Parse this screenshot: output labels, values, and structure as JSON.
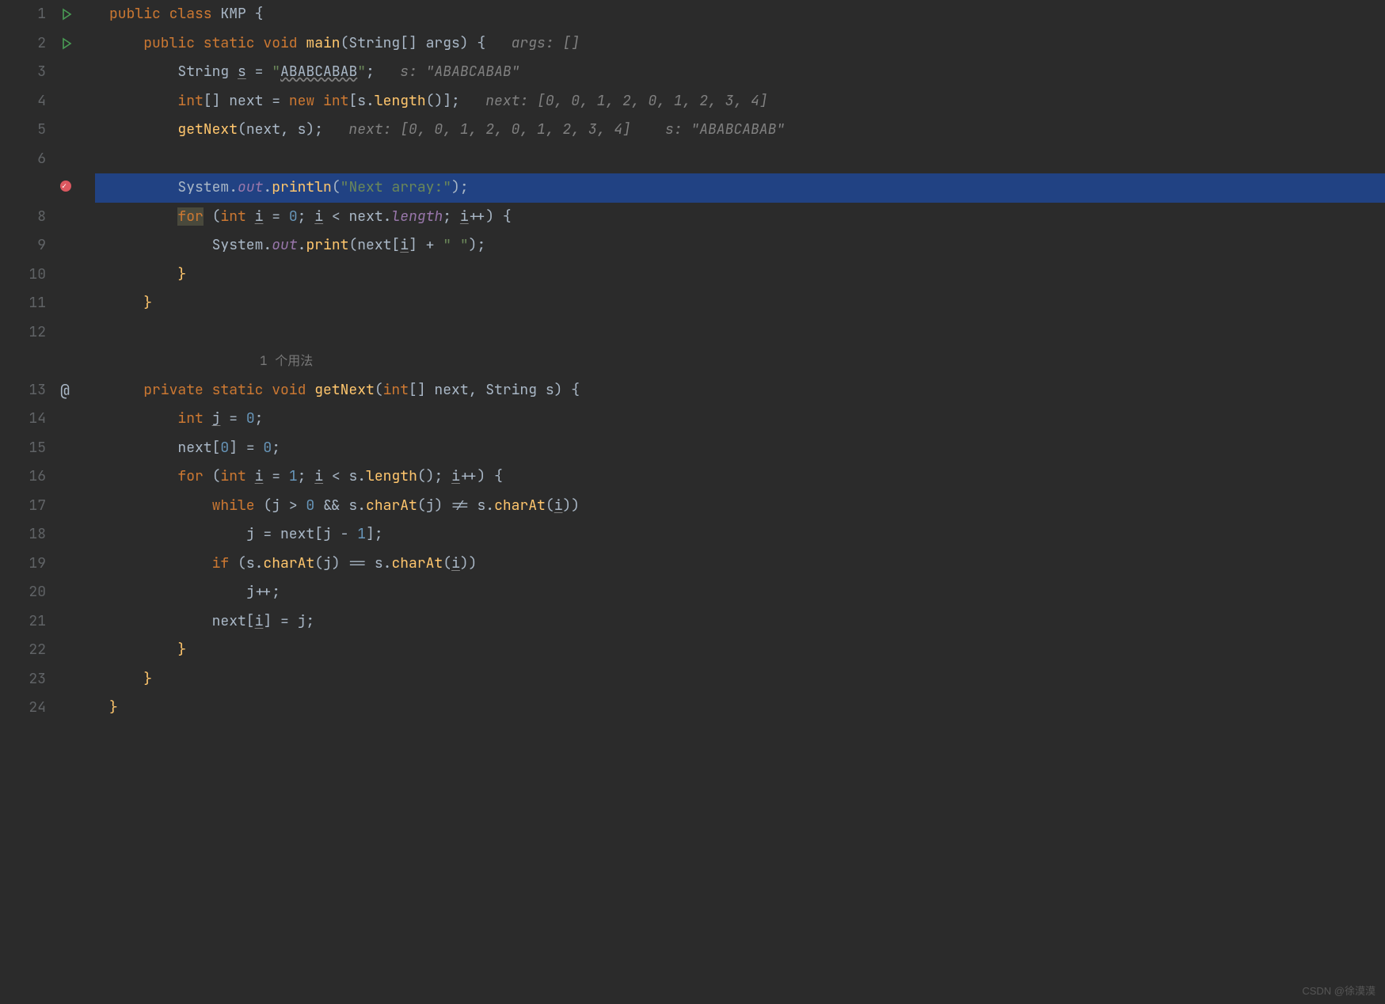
{
  "lineNumbers": [
    "1",
    "2",
    "3",
    "4",
    "5",
    "6",
    "",
    "8",
    "9",
    "10",
    "11",
    "12",
    "",
    "13",
    "14",
    "15",
    "16",
    "17",
    "18",
    "19",
    "20",
    "21",
    "22",
    "23",
    "24"
  ],
  "gutterIcons": [
    "run",
    "run",
    "",
    "",
    "",
    "",
    "breakpoint",
    "",
    "",
    "",
    "",
    "",
    "",
    "at",
    "",
    "",
    "",
    "",
    "",
    "",
    "",
    "",
    "",
    "",
    ""
  ],
  "highlightRow": 6,
  "usageHint": "1 个用法",
  "watermark": "CSDN @徐漠漠",
  "code": {
    "l1": {
      "tokens": [
        [
          "kw",
          "public "
        ],
        [
          "kw",
          "class "
        ],
        [
          "op",
          "KMP "
        ],
        [
          "brace",
          "{"
        ]
      ]
    },
    "l2": {
      "tokens": [
        [
          "",
          "    "
        ],
        [
          "kw",
          "public static "
        ],
        [
          "kw",
          "void "
        ],
        [
          "method",
          "main"
        ],
        [
          "op",
          "(String[] args) "
        ],
        [
          "brace",
          "{"
        ],
        [
          "comment",
          "   args: []"
        ]
      ]
    },
    "l3": {
      "tokens": [
        [
          "",
          "        "
        ],
        [
          "op",
          "String "
        ],
        [
          "underline",
          "s"
        ],
        [
          "op",
          " = "
        ],
        [
          "str",
          "\""
        ],
        [
          "wavy",
          "ABABCABAB"
        ],
        [
          "str",
          "\""
        ],
        [
          "op",
          ";"
        ],
        [
          "comment",
          "   s: \"ABABCABAB\""
        ]
      ]
    },
    "l4": {
      "tokens": [
        [
          "",
          "        "
        ],
        [
          "kw",
          "int"
        ],
        [
          "op",
          "[] "
        ],
        [
          "op",
          "next = "
        ],
        [
          "kw",
          "new int"
        ],
        [
          "op",
          "[s."
        ],
        [
          "method",
          "length"
        ],
        [
          "op",
          "()];"
        ],
        [
          "comment",
          "   next: [0, 0, 1, 2, 0, 1, 2, 3, 4]"
        ]
      ]
    },
    "l5": {
      "tokens": [
        [
          "",
          "        "
        ],
        [
          "method",
          "getNext"
        ],
        [
          "op",
          "(next, s);"
        ],
        [
          "comment",
          "   next: [0, 0, 1, 2, 0, 1, 2, 3, 4]    s: \"ABABCABAB\""
        ]
      ]
    },
    "l6": {
      "tokens": [
        [
          "",
          ""
        ]
      ]
    },
    "l7": {
      "tokens": [
        [
          "",
          "        "
        ],
        [
          "op",
          "System."
        ],
        [
          "field",
          "out"
        ],
        [
          "op",
          "."
        ],
        [
          "method",
          "println"
        ],
        [
          "op",
          "("
        ],
        [
          "str",
          "\"Next array:\""
        ],
        [
          "op",
          ");"
        ]
      ]
    },
    "l8": {
      "tokens": [
        [
          "",
          "        "
        ],
        [
          "selkw",
          "for"
        ],
        [
          "op",
          " ("
        ],
        [
          "kw",
          "int "
        ],
        [
          "underline",
          "i"
        ],
        [
          "op",
          " = "
        ],
        [
          "num",
          "0"
        ],
        [
          "op",
          "; "
        ],
        [
          "underline",
          "i"
        ],
        [
          "op",
          " < next."
        ],
        [
          "field",
          "length"
        ],
        [
          "op",
          "; "
        ],
        [
          "underline",
          "i"
        ],
        [
          "op",
          "++) "
        ],
        [
          "brace",
          "{"
        ]
      ]
    },
    "l9": {
      "tokens": [
        [
          "",
          "            "
        ],
        [
          "op",
          "System."
        ],
        [
          "field",
          "out"
        ],
        [
          "op",
          "."
        ],
        [
          "method",
          "print"
        ],
        [
          "op",
          "(next["
        ],
        [
          "underline",
          "i"
        ],
        [
          "op",
          "] + "
        ],
        [
          "str",
          "\" \""
        ],
        [
          "op",
          ");"
        ]
      ]
    },
    "l10": {
      "tokens": [
        [
          "",
          "        "
        ],
        [
          "cbrace",
          "}"
        ]
      ]
    },
    "l11": {
      "tokens": [
        [
          "",
          "    "
        ],
        [
          "cbrace",
          "}"
        ]
      ]
    },
    "l12": {
      "tokens": [
        [
          "",
          ""
        ]
      ]
    },
    "l13": {
      "tokens": [
        [
          "",
          "    "
        ],
        [
          "kw",
          "private static "
        ],
        [
          "kw",
          "void "
        ],
        [
          "method",
          "getNext"
        ],
        [
          "op",
          "("
        ],
        [
          "kw",
          "int"
        ],
        [
          "op",
          "[] next, String s) "
        ],
        [
          "brace",
          "{"
        ]
      ]
    },
    "l14": {
      "tokens": [
        [
          "",
          "        "
        ],
        [
          "kw",
          "int "
        ],
        [
          "underline",
          "j"
        ],
        [
          "op",
          " = "
        ],
        [
          "num",
          "0"
        ],
        [
          "op",
          ";"
        ]
      ]
    },
    "l15": {
      "tokens": [
        [
          "",
          "        "
        ],
        [
          "op",
          "next["
        ],
        [
          "num",
          "0"
        ],
        [
          "op",
          "] = "
        ],
        [
          "num",
          "0"
        ],
        [
          "op",
          ";"
        ]
      ]
    },
    "l16": {
      "tokens": [
        [
          "",
          "        "
        ],
        [
          "kw",
          "for "
        ],
        [
          "op",
          "("
        ],
        [
          "kw",
          "int "
        ],
        [
          "underline",
          "i"
        ],
        [
          "op",
          " = "
        ],
        [
          "num",
          "1"
        ],
        [
          "op",
          "; "
        ],
        [
          "underline",
          "i"
        ],
        [
          "op",
          " < s."
        ],
        [
          "method",
          "length"
        ],
        [
          "op",
          "(); "
        ],
        [
          "underline",
          "i"
        ],
        [
          "op",
          "++) "
        ],
        [
          "brace",
          "{"
        ]
      ]
    },
    "l17": {
      "tokens": [
        [
          "",
          "            "
        ],
        [
          "kw",
          "while "
        ],
        [
          "op",
          "(j > "
        ],
        [
          "num",
          "0"
        ],
        [
          "op",
          " && s."
        ],
        [
          "method",
          "charAt"
        ],
        [
          "op",
          "(j) != s."
        ],
        [
          "method",
          "charAt"
        ],
        [
          "op",
          "("
        ],
        [
          "underline",
          "i"
        ],
        [
          "op",
          "))"
        ]
      ]
    },
    "l18": {
      "tokens": [
        [
          "",
          "                "
        ],
        [
          "op",
          "j = next[j - "
        ],
        [
          "num",
          "1"
        ],
        [
          "op",
          "];"
        ]
      ]
    },
    "l19": {
      "tokens": [
        [
          "",
          "            "
        ],
        [
          "kw",
          "if "
        ],
        [
          "op",
          "(s."
        ],
        [
          "method",
          "charAt"
        ],
        [
          "op",
          "(j) == s."
        ],
        [
          "method",
          "charAt"
        ],
        [
          "op",
          "("
        ],
        [
          "underline",
          "i"
        ],
        [
          "op",
          "))"
        ]
      ]
    },
    "l20": {
      "tokens": [
        [
          "",
          "                "
        ],
        [
          "op",
          "j++;"
        ]
      ]
    },
    "l21": {
      "tokens": [
        [
          "",
          "            "
        ],
        [
          "op",
          "next["
        ],
        [
          "underline",
          "i"
        ],
        [
          "op",
          "] = j;"
        ]
      ]
    },
    "l22": {
      "tokens": [
        [
          "",
          "        "
        ],
        [
          "cbrace",
          "}"
        ]
      ]
    },
    "l23": {
      "tokens": [
        [
          "",
          "    "
        ],
        [
          "cbrace",
          "}"
        ]
      ]
    },
    "l24": {
      "tokens": [
        [
          "cbrace",
          "}"
        ]
      ]
    }
  }
}
